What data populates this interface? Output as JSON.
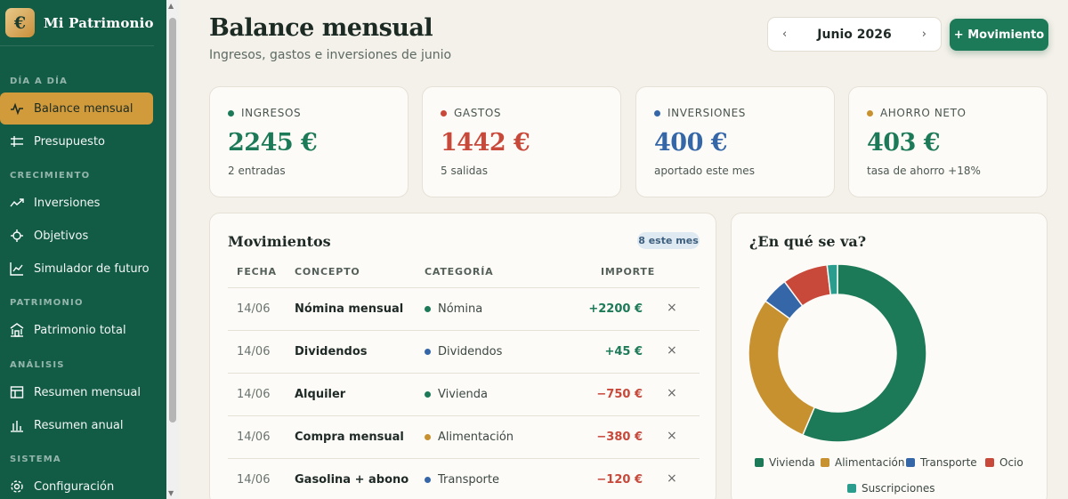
{
  "app": {
    "brand_icon": "€",
    "brand_name": "Mi Patrimonio"
  },
  "sidebar": {
    "sections": [
      {
        "label": "DÍA A DÍA"
      },
      {
        "label": "CRECIMIENTO"
      },
      {
        "label": "PATRIMONIO"
      },
      {
        "label": "ANÁLISIS"
      },
      {
        "label": "SISTEMA"
      }
    ],
    "items": [
      {
        "label": "Balance mensual",
        "icon": "pulse-icon",
        "active": true
      },
      {
        "label": "Presupuesto",
        "icon": "sliders-icon"
      },
      {
        "label": "Inversiones",
        "icon": "trend-icon"
      },
      {
        "label": "Objetivos",
        "icon": "target-icon"
      },
      {
        "label": "Simulador de futuro",
        "icon": "line-chart-icon"
      },
      {
        "label": "Patrimonio total",
        "icon": "bank-icon"
      },
      {
        "label": "Resumen mensual",
        "icon": "table-icon"
      },
      {
        "label": "Resumen anual",
        "icon": "bar-chart-icon"
      },
      {
        "label": "Configuración",
        "icon": "gear-icon"
      }
    ]
  },
  "header": {
    "title": "Balance mensual",
    "subtitle": "Ingresos, gastos e inversiones de junio",
    "month_label": "Junio 2026",
    "prev": "‹",
    "next": "›",
    "add_button": "+ Movimiento"
  },
  "kpis": [
    {
      "label": "INGRESOS",
      "value": "2245 €",
      "sub": "2 entradas",
      "color": "#1c7a58"
    },
    {
      "label": "GASTOS",
      "value": "1442 €",
      "sub": "5 salidas",
      "color": "#c8483a"
    },
    {
      "label": "INVERSIONES",
      "value": "400 €",
      "sub": "aportado este mes",
      "color": "#3567a8"
    },
    {
      "label": "AHORRO NETO",
      "value": "403 €",
      "sub": "tasa de ahorro +18%",
      "color": "#c8912f"
    }
  ],
  "movements": {
    "title": "Movimientos",
    "badge": "8 este mes",
    "columns": {
      "date": "FECHA",
      "concept": "CONCEPTO",
      "category": "CATEGORÍA",
      "amount": "IMPORTE"
    },
    "delete_icon": "×",
    "rows": [
      {
        "date": "14/06",
        "concept": "Nómina mensual",
        "category": "Nómina",
        "cat_color": "#1c7a58",
        "amount": "+2200 €",
        "positive": true
      },
      {
        "date": "14/06",
        "concept": "Dividendos",
        "category": "Dividendos",
        "cat_color": "#3567a8",
        "amount": "+45 €",
        "positive": true
      },
      {
        "date": "14/06",
        "concept": "Alquiler",
        "category": "Vivienda",
        "cat_color": "#1c7a58",
        "amount": "−750 €",
        "positive": false
      },
      {
        "date": "14/06",
        "concept": "Compra mensual",
        "category": "Alimentación",
        "cat_color": "#c8912f",
        "amount": "−380 €",
        "positive": false
      },
      {
        "date": "14/06",
        "concept": "Gasolina + abono",
        "category": "Transporte",
        "cat_color": "#3567a8",
        "amount": "−120 €",
        "positive": false
      }
    ]
  },
  "chart_data": {
    "type": "pie",
    "title": "¿En qué se va?",
    "categories": [
      "Vivienda",
      "Alimentación",
      "Transporte",
      "Ocio",
      "Suscripciones"
    ],
    "values": [
      750,
      380,
      65,
      110,
      25
    ],
    "colors": [
      "#1c7a58",
      "#c8912f",
      "#3567a8",
      "#c8483a",
      "#2a9d8f"
    ],
    "legend": "bottom"
  }
}
